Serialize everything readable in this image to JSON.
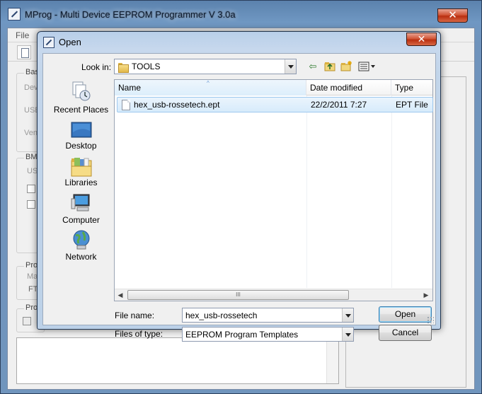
{
  "main_window": {
    "title": "MProg - Multi Device EEPROM Programmer V 3.0a",
    "close_glyph": "✕",
    "menu": {
      "file": "File"
    },
    "partial_labels": [
      "Bas",
      "Dev",
      "USB",
      "Ven",
      "BM",
      "US",
      "Pro",
      "Ma",
      "FT",
      "Pro"
    ]
  },
  "dialog": {
    "title": "Open",
    "close_glyph": "✕",
    "look_in": {
      "label": "Look in:",
      "value": "TOOLS"
    },
    "places": [
      {
        "label": "Recent Places",
        "icon": "recent-places-icon"
      },
      {
        "label": "Desktop",
        "icon": "desktop-icon"
      },
      {
        "label": "Libraries",
        "icon": "libraries-icon"
      },
      {
        "label": "Computer",
        "icon": "computer-icon"
      },
      {
        "label": "Network",
        "icon": "network-icon"
      }
    ],
    "columns": {
      "name": "Name",
      "date": "Date modified",
      "type": "Type"
    },
    "files": [
      {
        "name": "hex_usb-rossetech.ept",
        "date": "22/2/2011 7:27",
        "type": "EPT File"
      }
    ],
    "scroll_thumb_glyph": "III",
    "file_name": {
      "label": "File name:",
      "value": "hex_usb-rossetech"
    },
    "file_type": {
      "label": "Files of type:",
      "value": "EEPROM Program Templates"
    },
    "buttons": {
      "open": "Open",
      "cancel": "Cancel"
    }
  }
}
